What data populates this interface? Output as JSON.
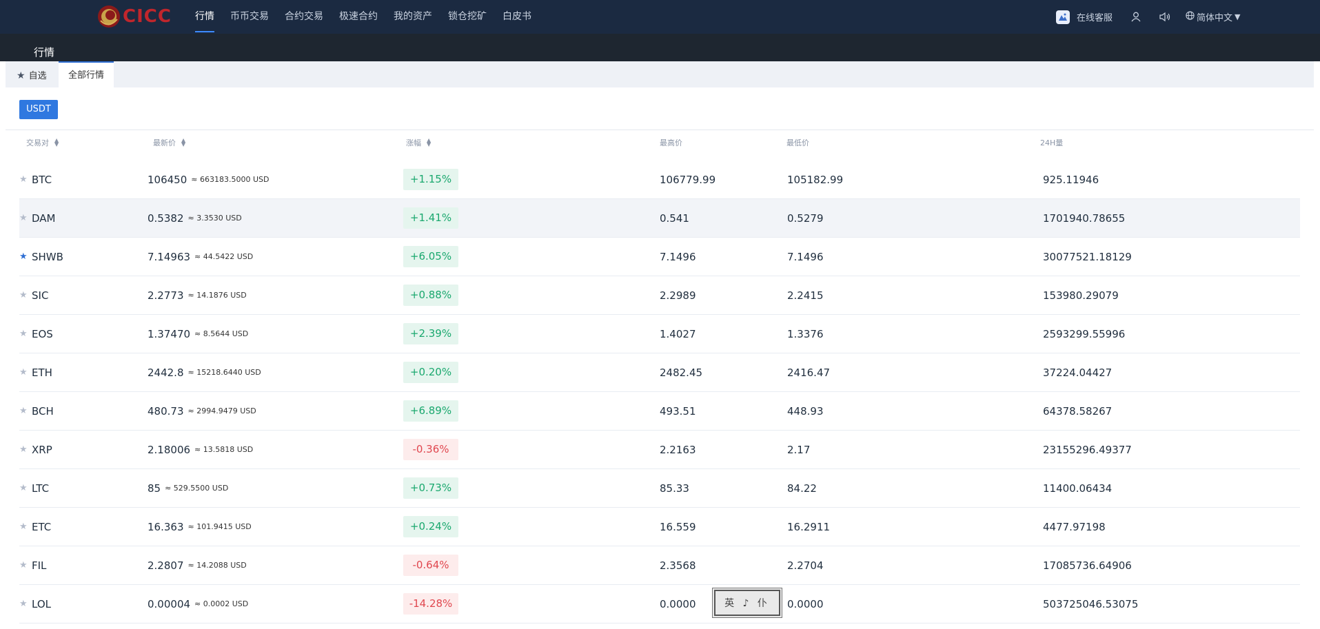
{
  "brand": {
    "name": "CICC",
    "accent": "#c0262c"
  },
  "nav": {
    "items": [
      "行情",
      "币币交易",
      "合约交易",
      "极速合约",
      "我的资产",
      "锁仓挖矿",
      "白皮书"
    ],
    "active_index": 0,
    "customer_service": "在线客服",
    "language": "简体中文",
    "icons": [
      "user-icon",
      "speaker-icon",
      "globe-icon"
    ]
  },
  "page": {
    "title": "行情"
  },
  "tabs": {
    "favorites": "自选",
    "all": "全部行情",
    "active": "all"
  },
  "filter": {
    "quote": "USDT"
  },
  "table": {
    "headers": {
      "pair": "交易对",
      "last_price": "最新价",
      "change": "涨幅",
      "high": "最高价",
      "low": "最低价",
      "volume": "24H量"
    },
    "rows": [
      {
        "symbol": "BTC",
        "price": "106450",
        "usd": "≈ 663183.5000 USD",
        "change": "+1.15%",
        "dir": "up",
        "high": "106779.99",
        "low": "105182.99",
        "volume": "925.11946",
        "starred": false
      },
      {
        "symbol": "DAM",
        "price": "0.5382",
        "usd": "≈ 3.3530 USD",
        "change": "+1.41%",
        "dir": "up",
        "high": "0.541",
        "low": "0.5279",
        "volume": "1701940.78655",
        "starred": false
      },
      {
        "symbol": "SHWB",
        "price": "7.14963",
        "usd": "≈ 44.5422 USD",
        "change": "+6.05%",
        "dir": "up",
        "high": "7.1496",
        "low": "7.1496",
        "volume": "30077521.18129",
        "starred": true
      },
      {
        "symbol": "SIC",
        "price": "2.2773",
        "usd": "≈ 14.1876 USD",
        "change": "+0.88%",
        "dir": "up",
        "high": "2.2989",
        "low": "2.2415",
        "volume": "153980.29079",
        "starred": false
      },
      {
        "symbol": "EOS",
        "price": "1.37470",
        "usd": "≈ 8.5644 USD",
        "change": "+2.39%",
        "dir": "up",
        "high": "1.4027",
        "low": "1.3376",
        "volume": "2593299.55996",
        "starred": false
      },
      {
        "symbol": "ETH",
        "price": "2442.8",
        "usd": "≈ 15218.6440 USD",
        "change": "+0.20%",
        "dir": "up",
        "high": "2482.45",
        "low": "2416.47",
        "volume": "37224.04427",
        "starred": false
      },
      {
        "symbol": "BCH",
        "price": "480.73",
        "usd": "≈ 2994.9479 USD",
        "change": "+6.89%",
        "dir": "up",
        "high": "493.51",
        "low": "448.93",
        "volume": "64378.58267",
        "starred": false
      },
      {
        "symbol": "XRP",
        "price": "2.18006",
        "usd": "≈ 13.5818 USD",
        "change": "-0.36%",
        "dir": "down",
        "high": "2.2163",
        "low": "2.17",
        "volume": "23155296.49377",
        "starred": false
      },
      {
        "symbol": "LTC",
        "price": "85",
        "usd": "≈ 529.5500 USD",
        "change": "+0.73%",
        "dir": "up",
        "high": "85.33",
        "low": "84.22",
        "volume": "11400.06434",
        "starred": false
      },
      {
        "symbol": "ETC",
        "price": "16.363",
        "usd": "≈ 101.9415 USD",
        "change": "+0.24%",
        "dir": "up",
        "high": "16.559",
        "low": "16.2911",
        "volume": "4477.97198",
        "starred": false
      },
      {
        "symbol": "FIL",
        "price": "2.2807",
        "usd": "≈ 14.2088 USD",
        "change": "-0.64%",
        "dir": "down",
        "high": "2.3568",
        "low": "2.2704",
        "volume": "17085736.64906",
        "starred": false
      },
      {
        "symbol": "LOL",
        "price": "0.00004",
        "usd": "≈ 0.0002 USD",
        "change": "-14.28%",
        "dir": "down",
        "high": "0.0000",
        "low": "0.0000",
        "volume": "503725046.53075",
        "starred": false
      }
    ],
    "highlighted_row": 1
  },
  "overlay_stamp": "英 ♪ 仆",
  "colors": {
    "nav_bg": "#1b2a41",
    "up": "#1aa86e",
    "down": "#e0474f",
    "primary": "#2f78e0"
  }
}
